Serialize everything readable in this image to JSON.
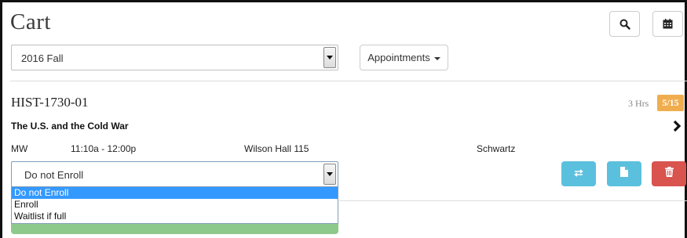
{
  "page": {
    "title": "Cart"
  },
  "toolbar": {
    "search_icon": "search-icon",
    "calendar_icon": "calendar-icon"
  },
  "term_select": {
    "value": "2016 Fall"
  },
  "appointments_button": {
    "label": "Appointments"
  },
  "course": {
    "code": "HIST-1730-01",
    "hours": "3 Hrs",
    "seats": "5/15",
    "title": "The U.S. and the Cold War",
    "days": "MW",
    "time": "11:10a - 12:00p",
    "location": "Wilson Hall 115",
    "instructor": "Schwartz"
  },
  "enroll_select": {
    "value": "Do not Enroll",
    "options": [
      "Do not Enroll",
      "Enroll",
      "Waitlist if full"
    ],
    "selected_index": 0
  },
  "actions": {
    "swap_icon": "swap-arrows-icon",
    "file_icon": "file-icon",
    "trash_icon": "trash-icon"
  },
  "colors": {
    "badge": "#f0ad4e",
    "info": "#5bc0de",
    "danger": "#d9534f",
    "highlight": "#3399ff",
    "success_bar": "#8ec98c"
  }
}
